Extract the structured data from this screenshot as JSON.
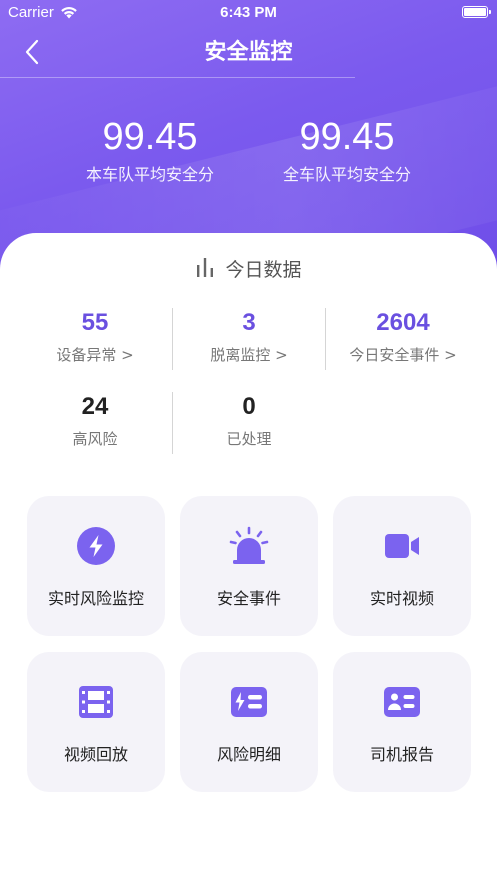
{
  "status_bar": {
    "carrier": "Carrier",
    "time": "6:43 PM"
  },
  "nav": {
    "title": "安全监控"
  },
  "scores": [
    {
      "value": "99.45",
      "label": "本车队平均安全分"
    },
    {
      "value": "99.45",
      "label": "全车队平均安全分"
    }
  ],
  "today": {
    "title": "今日数据",
    "stats": [
      {
        "value": "55",
        "label": "设备异常 >"
      },
      {
        "value": "3",
        "label": "脱离监控 >"
      },
      {
        "value": "2604",
        "label": "今日安全事件 >"
      },
      {
        "value": "24",
        "label": "高风险"
      },
      {
        "value": "0",
        "label": "已处理"
      }
    ]
  },
  "features": [
    {
      "label": "实时风险监控",
      "icon": "lightning-circle-icon"
    },
    {
      "label": "安全事件",
      "icon": "alarm-siren-icon"
    },
    {
      "label": "实时视频",
      "icon": "video-camera-icon"
    },
    {
      "label": "视频回放",
      "icon": "film-icon"
    },
    {
      "label": "风险明细",
      "icon": "risk-detail-icon"
    },
    {
      "label": "司机报告",
      "icon": "driver-card-icon"
    }
  ],
  "colors": {
    "header": "#7b5aee",
    "accent": "#6a50e0",
    "tile_bg": "#f4f3f9"
  }
}
